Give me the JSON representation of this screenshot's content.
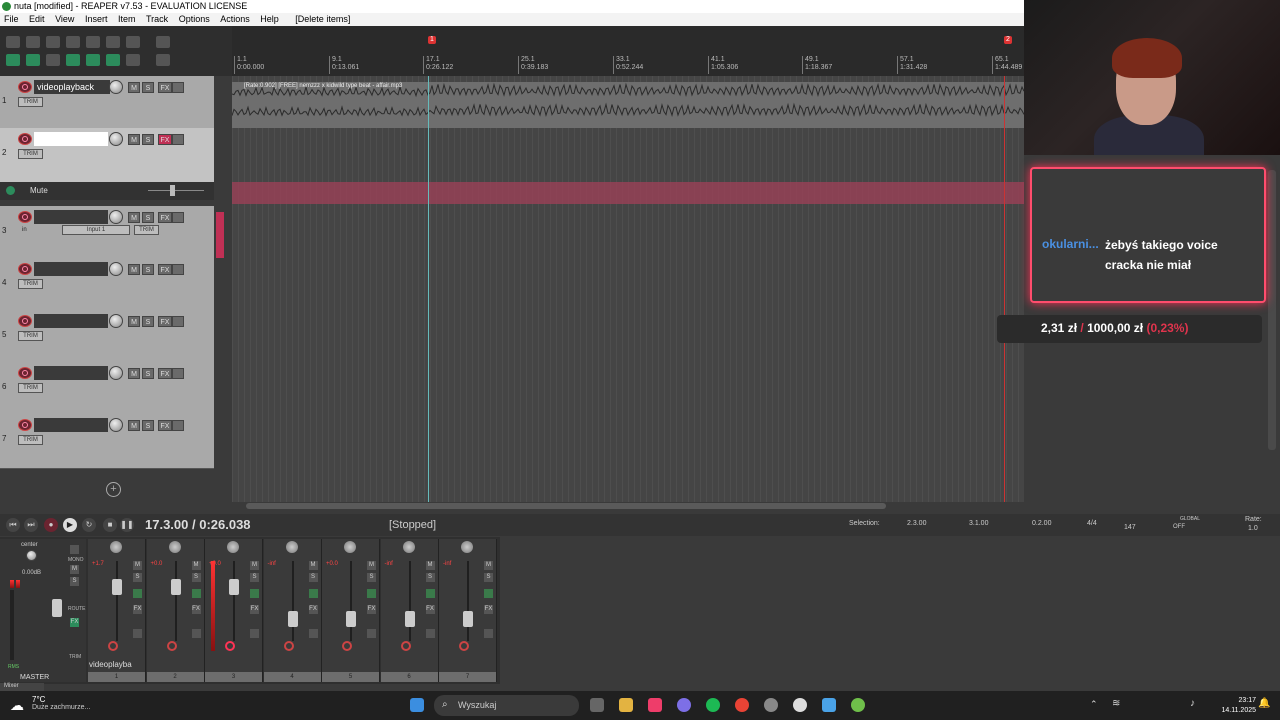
{
  "window": {
    "title": "nuta [modified] - REAPER v7.53 - EVALUATION LICENSE"
  },
  "menu": [
    "File",
    "Edit",
    "View",
    "Insert",
    "Item",
    "Track",
    "Options",
    "Actions",
    "Help",
    "[Delete items]"
  ],
  "ruler": {
    "markers": [
      "1",
      "2"
    ],
    "bars": [
      {
        "bar": "1.1",
        "time": "0:00.000"
      },
      {
        "bar": "9.1",
        "time": "0:13.061"
      },
      {
        "bar": "17.1",
        "time": "0:26.122"
      },
      {
        "bar": "25.1",
        "time": "0:39.183"
      },
      {
        "bar": "33.1",
        "time": "0:52.244"
      },
      {
        "bar": "41.1",
        "time": "1:05.306"
      },
      {
        "bar": "49.1",
        "time": "1:18.367"
      },
      {
        "bar": "57.1",
        "time": "1:31.428"
      },
      {
        "bar": "65.1",
        "time": "1:44.489"
      }
    ]
  },
  "tracks": [
    {
      "num": "1",
      "name": "videoplayback",
      "trim": "TRIM"
    },
    {
      "num": "2",
      "name": "",
      "trim": "TRIM"
    },
    {
      "num": "3",
      "name": "",
      "trim": "TRIM",
      "input": "Input 1",
      "in_label": "in"
    },
    {
      "num": "4",
      "name": "",
      "trim": "TRIM"
    },
    {
      "num": "5",
      "name": "",
      "trim": "TRIM"
    },
    {
      "num": "6",
      "name": "",
      "trim": "TRIM"
    },
    {
      "num": "7",
      "name": "",
      "trim": "TRIM"
    }
  ],
  "envelope": {
    "label": "Mute"
  },
  "item": {
    "label": "[Rate:0.902] [FREE] nemzzz x kidwild type beat - affair.mp3"
  },
  "buttons": {
    "m": "M",
    "s": "S",
    "fx": "FX",
    "add": "+"
  },
  "transport": {
    "time": "17.3.00 / 0:26.038",
    "status": "[Stopped]",
    "selection_label": "Selection:",
    "sel_start": "2.3.00",
    "sel_end": "3.1.00",
    "sel_len": "0.2.00",
    "timesig": "4/4",
    "bpm": "147",
    "global_label": "GLOBAL",
    "global_state": "OFF",
    "rate_label": "Rate:",
    "rate_value": "1.0"
  },
  "mixer": {
    "master_label": "MASTER",
    "master_pan": "center",
    "master_vol": "0.00dB",
    "route": "ROUTE",
    "trim": "TRIM",
    "mono": "MONO",
    "rms": "RMS",
    "strip_name": "videoplayba",
    "strip_vols": [
      "+1.7",
      "+0.0",
      "+0.0",
      "-inf",
      "+0.0",
      "-inf",
      "-inf"
    ],
    "strip_nums": [
      "1",
      "2",
      "3",
      "4",
      "5",
      "6",
      "7"
    ],
    "panel_label": "Mixer"
  },
  "stream": {
    "donor": "okularni...",
    "message": "żebyś takiego voice cracka nie miał",
    "goal_current": "2,31 zł",
    "goal_sep": "/",
    "goal_target": "1000,00 zł",
    "goal_pct": "(0,23%)"
  },
  "taskbar": {
    "temp": "7°C",
    "weather": "Duże zachmurze...",
    "search": "Wyszukaj",
    "time": "23:17",
    "date": "14.11.2025"
  },
  "colors": {
    "accent_red": "#c03055",
    "envelope": "#a04058",
    "donation_border": "#ff4d6d",
    "donor_blue": "#4a90e2"
  }
}
